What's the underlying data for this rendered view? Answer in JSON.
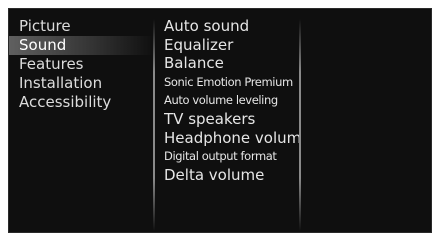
{
  "left_menu": {
    "items": [
      {
        "label": "Picture"
      },
      {
        "label": "Sound",
        "selected": true
      },
      {
        "label": "Features"
      },
      {
        "label": "Installation"
      },
      {
        "label": "Accessibility"
      }
    ]
  },
  "right_menu": {
    "items": [
      {
        "label": "Auto sound"
      },
      {
        "label": "Equalizer"
      },
      {
        "label": "Balance"
      },
      {
        "label": "Sonic Emotion Premium"
      },
      {
        "label": "Auto volume leveling"
      },
      {
        "label": "TV speakers"
      },
      {
        "label": "Headphone volume"
      },
      {
        "label": "Digital output format"
      },
      {
        "label": "Delta volume"
      }
    ]
  },
  "colors": {
    "background": "#0f0f0f",
    "text": "#e6e6e6",
    "selected_highlight": "#6e6e6e"
  }
}
